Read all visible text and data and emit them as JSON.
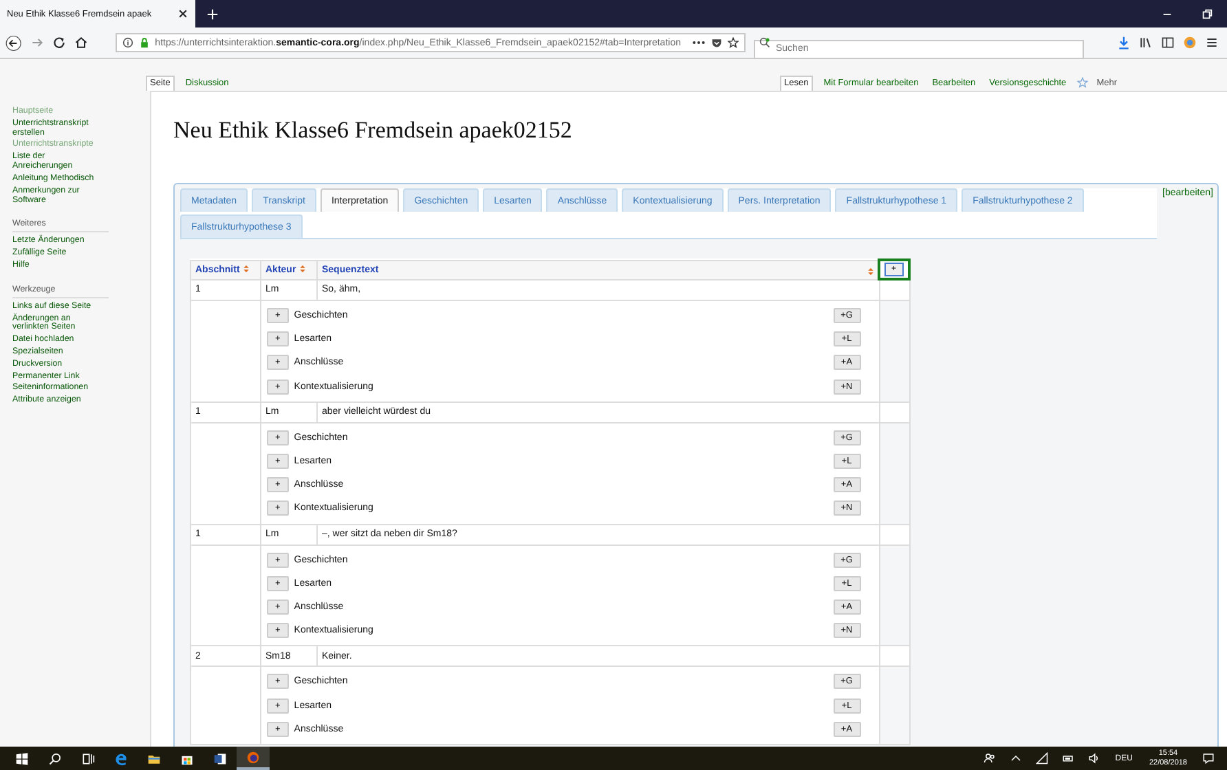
{
  "browser": {
    "tab_title": "Neu Ethik Klasse6 Fremdsein apaek",
    "url": "https://unterrichtsinteraktion.**semantic-cora.org**/index.php/Neu_Ethik_Klasse6_Fremdsein_apaek02152#tab=Interpretation",
    "search_placeholder": "Suchen"
  },
  "page_tabs": [
    {
      "label": "Seite",
      "selected": true
    },
    {
      "label": "Diskussion",
      "selected": false
    }
  ],
  "views": [
    {
      "label": "Lesen",
      "selected": true
    },
    {
      "label": "Mit Formular bearbeiten",
      "selected": false
    },
    {
      "label": "Bearbeiten",
      "selected": false
    },
    {
      "label": "Versionsgeschichte",
      "selected": false
    }
  ],
  "more": "Mehr",
  "sidebar": [
    {
      "items": [
        {
          "label": "Hauptseite",
          "visited": true
        },
        {
          "label": "Unterrichtstranskript erstellen",
          "visited": false
        },
        {
          "label": "Unterrichtstranskripte",
          "visited": true
        },
        {
          "label": "Liste der Anreicherungen",
          "visited": false
        },
        {
          "label": "Anleitung Methodisch",
          "visited": false
        },
        {
          "label": "Anmerkungen zur Software",
          "visited": false
        }
      ]
    },
    {
      "heading": "Weiteres",
      "items": [
        {
          "label": "Letzte Änderungen",
          "visited": false
        },
        {
          "label": "Zufällige Seite",
          "visited": false
        },
        {
          "label": "Hilfe",
          "visited": false
        }
      ]
    },
    {
      "heading": "Werkzeuge",
      "items": [
        {
          "label": "Links auf diese Seite",
          "visited": false
        },
        {
          "label": "Änderungen an verlinkten Seiten",
          "visited": false
        },
        {
          "label": "Datei hochladen",
          "visited": false
        },
        {
          "label": "Spezialseiten",
          "visited": false
        },
        {
          "label": "Druckversion",
          "visited": false
        },
        {
          "label": "Permanenter Link",
          "visited": false
        },
        {
          "label": "Seiteninformationen",
          "visited": false
        },
        {
          "label": "Attribute anzeigen",
          "visited": false
        }
      ]
    }
  ],
  "title": "Neu Ethik Klasse6 Fremdsein apaek02152",
  "edit_link": "[bearbeiten]",
  "tabs": [
    {
      "label": "Metadaten",
      "selected": false
    },
    {
      "label": "Transkript",
      "selected": false
    },
    {
      "label": "Interpretation",
      "selected": true
    },
    {
      "label": "Geschichten",
      "selected": false
    },
    {
      "label": "Lesarten",
      "selected": false
    },
    {
      "label": "Anschlüsse",
      "selected": false
    },
    {
      "label": "Kontextualisierung",
      "selected": false
    },
    {
      "label": "Pers. Interpretation",
      "selected": false
    },
    {
      "label": "Fallstrukturhypothese 1",
      "selected": false
    },
    {
      "label": "Fallstrukturhypothese 2",
      "selected": false
    },
    {
      "label": "Fallstrukturhypothese 3",
      "selected": false
    }
  ],
  "table": {
    "columns": [
      "Abschnitt",
      "Akteur",
      "Sequenztext"
    ],
    "add_button": "+",
    "rows": [
      {
        "abschnitt": "1",
        "akteur": "Lm",
        "text": "So, ähm,",
        "actions": [
          {
            "plus": "+",
            "label": "Geschichten",
            "key": "+G"
          },
          {
            "plus": "+",
            "label": "Lesarten",
            "key": "+L"
          },
          {
            "plus": "+",
            "label": "Anschlüsse",
            "key": "+A"
          },
          {
            "plus": "+",
            "label": "Kontextualisierung",
            "key": "+N"
          }
        ]
      },
      {
        "abschnitt": "1",
        "akteur": "Lm",
        "text": "aber vielleicht würdest du",
        "actions": [
          {
            "plus": "+",
            "label": "Geschichten",
            "key": "+G"
          },
          {
            "plus": "+",
            "label": "Lesarten",
            "key": "+L"
          },
          {
            "plus": "+",
            "label": "Anschlüsse",
            "key": "+A"
          },
          {
            "plus": "+",
            "label": "Kontextualisierung",
            "key": "+N"
          }
        ]
      },
      {
        "abschnitt": "1",
        "akteur": "Lm",
        "text": "–, wer sitzt da neben dir Sm18?",
        "actions": [
          {
            "plus": "+",
            "label": "Geschichten",
            "key": "+G"
          },
          {
            "plus": "+",
            "label": "Lesarten",
            "key": "+L"
          },
          {
            "plus": "+",
            "label": "Anschlüsse",
            "key": "+A"
          },
          {
            "plus": "+",
            "label": "Kontextualisierung",
            "key": "+N"
          }
        ]
      },
      {
        "abschnitt": "2",
        "akteur": "Sm18",
        "text": "Keiner.",
        "actions": [
          {
            "plus": "+",
            "label": "Geschichten",
            "key": "+G"
          },
          {
            "plus": "+",
            "label": "Lesarten",
            "key": "+L"
          },
          {
            "plus": "+",
            "label": "Anschlüsse",
            "key": "+A"
          }
        ]
      }
    ]
  },
  "taskbar": {
    "language": "DEU",
    "time": "15:54",
    "date": "22/08/2018"
  }
}
